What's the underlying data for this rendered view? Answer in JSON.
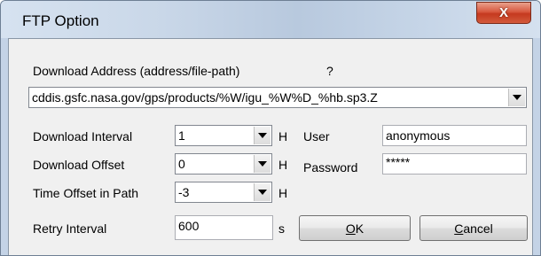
{
  "window": {
    "title": "FTP Option",
    "close_glyph": "X"
  },
  "download_address": {
    "label": "Download Address (address/file-path)",
    "help": "?",
    "value": "cddis.gsfc.nasa.gov/gps/products/%W/igu_%W%D_%hb.sp3.Z"
  },
  "download_interval": {
    "label": "Download Interval",
    "value": "1",
    "unit": "H"
  },
  "download_offset": {
    "label": "Download Offset",
    "value": "0",
    "unit": "H"
  },
  "time_offset": {
    "label": "Time Offset in Path",
    "value": "-3",
    "unit": "H"
  },
  "retry_interval": {
    "label": "Retry Interval",
    "value": "600",
    "unit": "s"
  },
  "user": {
    "label": "User",
    "value": "anonymous"
  },
  "password": {
    "label": "Password",
    "value": "*****"
  },
  "buttons": {
    "ok_mnemonic": "O",
    "ok_rest": "K",
    "cancel_mnemonic": "C",
    "cancel_rest": "ancel"
  },
  "icons": {
    "close": "close-icon",
    "dropdown": "chevron-down-icon"
  }
}
